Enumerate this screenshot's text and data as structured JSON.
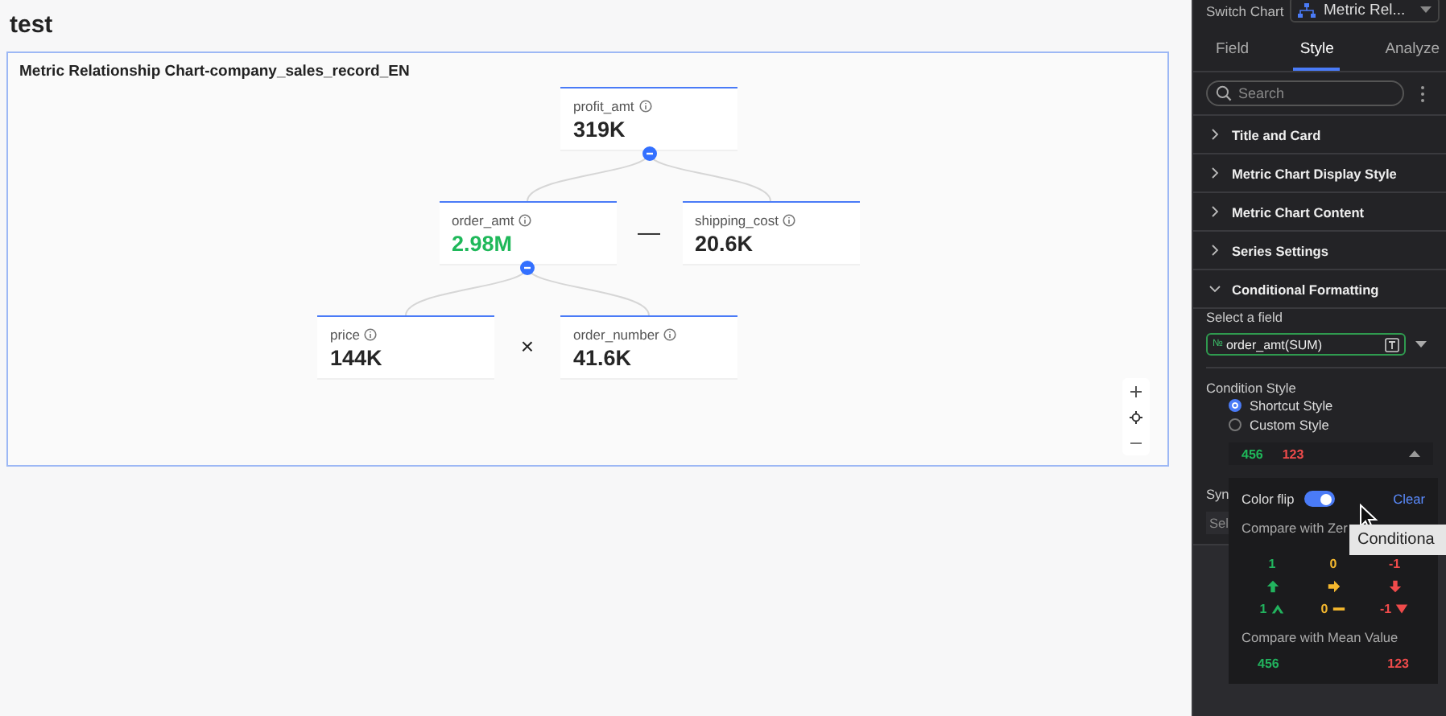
{
  "page_title": "test",
  "chart_card": {
    "title": "Metric Relationship Chart-company_sales_record_EN",
    "tree": {
      "label": "profit_amt",
      "value": "319K",
      "color": "#262626",
      "expanded": true,
      "operator": "—",
      "children": [
        {
          "label": "order_amt",
          "value": "2.98M",
          "color": "#1fb85a",
          "expanded": true,
          "operator": "×",
          "children": [
            {
              "label": "price",
              "value": "144K",
              "color": "#262626"
            },
            {
              "label": "order_number",
              "value": "41.6K",
              "color": "#262626"
            }
          ]
        },
        {
          "label": "shipping_cost",
          "value": "20.6K",
          "color": "#262626"
        }
      ]
    }
  },
  "side_panel": {
    "switch_chart": {
      "label": "Switch Chart",
      "value": "Metric Rel..."
    },
    "tabs": [
      {
        "label": "Field",
        "selected": false
      },
      {
        "label": "Style",
        "selected": true
      },
      {
        "label": "Analyze",
        "selected": false
      }
    ],
    "search": {
      "placeholder": "Search"
    },
    "sections": [
      {
        "title": "Title and Card",
        "expanded": false
      },
      {
        "title": "Metric Chart Display Style",
        "expanded": false
      },
      {
        "title": "Metric Chart Content",
        "expanded": false
      },
      {
        "title": "Series Settings",
        "expanded": false
      },
      {
        "title": "Conditional Formatting",
        "expanded": true
      }
    ],
    "select_field": {
      "label": "Select a field",
      "badge": "№",
      "value": "order_amt(SUM)"
    },
    "condition_style": {
      "label": "Condition Style",
      "options": [
        {
          "label": "Shortcut Style",
          "selected": true
        },
        {
          "label": "Custom Style",
          "selected": false
        }
      ],
      "preview": [
        {
          "text": "456",
          "color": "#1fb85a"
        },
        {
          "text": "123",
          "color": "#f04b4b"
        }
      ]
    },
    "covered": {
      "label": "Syn",
      "field": "Sel"
    },
    "popover": {
      "color_flip": {
        "label": "Color flip",
        "on": true
      },
      "clear": "Clear",
      "zero": {
        "title": "Compare with Zer",
        "columns": [
          {
            "value": "1",
            "marked_value": "1",
            "color": "#22b35e",
            "kind": "up"
          },
          {
            "value": "0",
            "marked_value": "0",
            "color": "#f5b82e",
            "kind": "flat"
          },
          {
            "value": "-1",
            "marked_value": "-1",
            "color": "#f04b4b",
            "kind": "down"
          }
        ]
      },
      "mean": {
        "title": "Compare with Mean Value",
        "values": [
          {
            "text": "456",
            "color": "#22b35e"
          },
          {
            "text": "123",
            "color": "#f04b4b"
          }
        ]
      }
    },
    "tooltip": {
      "text": "Conditiona"
    }
  }
}
